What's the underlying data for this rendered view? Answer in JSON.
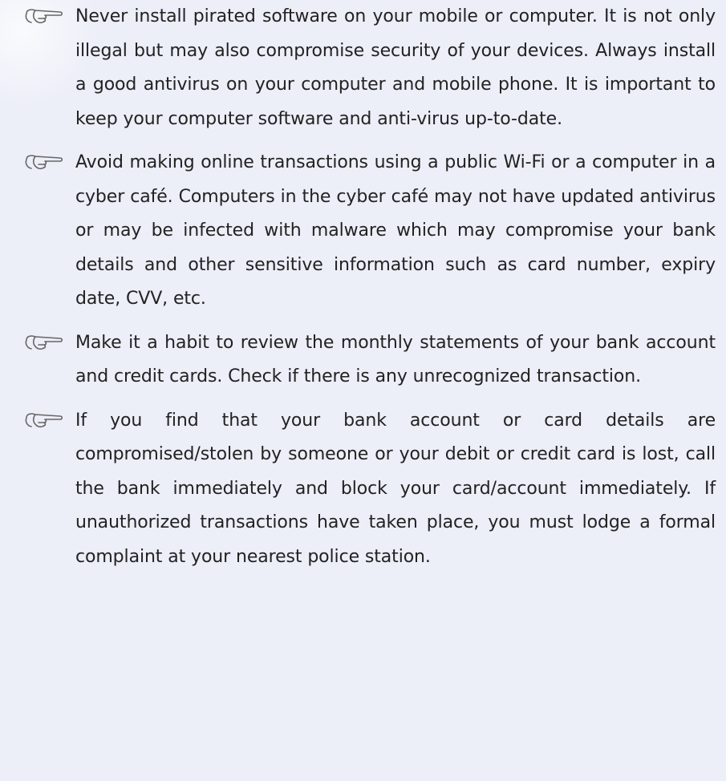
{
  "icon": "pointing-hand-icon",
  "tips": [
    {
      "text": "Never install pirated software on your mobile or computer. It is not only illegal but may also compromise security of your devices. Always install a good antivirus on your computer and mobile phone. It is important to keep your computer software and anti-virus up-to-date."
    },
    {
      "text": "Avoid making online transactions using a public Wi-Fi or a computer in a cyber café. Computers in the cyber café may not have updated antivirus or may be infected with malware which may compromise your bank details and other sensitive information such as card number, expiry date, CVV, etc."
    },
    {
      "text": "Make it a habit to review the monthly statements of your bank account and credit cards. Check if there is any unrecognized transaction."
    },
    {
      "text": "If you find that your bank account or card details are compromised/stolen by someone or your debit or credit card is lost, call the bank immediately and block your card/account immediately. If unauthorized transactions have taken place, you must lodge a formal complaint at your nearest police station."
    }
  ]
}
